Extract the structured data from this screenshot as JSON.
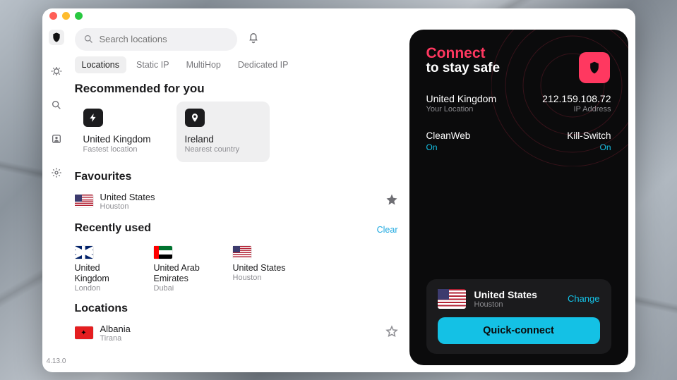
{
  "version": "4.13.0",
  "search": {
    "placeholder": "Search locations"
  },
  "tabs": [
    "Locations",
    "Static IP",
    "MultiHop",
    "Dedicated IP"
  ],
  "sections": {
    "recommended": "Recommended for you",
    "favourites": "Favourites",
    "recent": "Recently used",
    "locations": "Locations",
    "clear": "Clear"
  },
  "recommended": [
    {
      "title": "United Kingdom",
      "subtitle": "Fastest location",
      "icon": "bolt"
    },
    {
      "title": "Ireland",
      "subtitle": "Nearest country",
      "icon": "pin"
    }
  ],
  "favourites": [
    {
      "country": "United States",
      "city": "Houston",
      "flag": "us"
    }
  ],
  "recent": [
    {
      "country": "United Kingdom",
      "city": "London",
      "flag": "uk"
    },
    {
      "country": "United Arab Emirates",
      "city": "Dubai",
      "flag": "uae"
    },
    {
      "country": "United States",
      "city": "Houston",
      "flag": "us"
    }
  ],
  "locations": [
    {
      "country": "Albania",
      "city": "Tirana",
      "flag": "al"
    }
  ],
  "panel": {
    "headline1": "Connect",
    "headline2": "to stay safe",
    "location_label": "United Kingdom",
    "location_sub": "Your Location",
    "ip_value": "212.159.108.72",
    "ip_sub": "IP Address",
    "cleanweb_label": "CleanWeb",
    "cleanweb_state": "On",
    "killswitch_label": "Kill-Switch",
    "killswitch_state": "On",
    "selected_country": "United States",
    "selected_city": "Houston",
    "change": "Change",
    "connect_btn": "Quick-connect"
  }
}
